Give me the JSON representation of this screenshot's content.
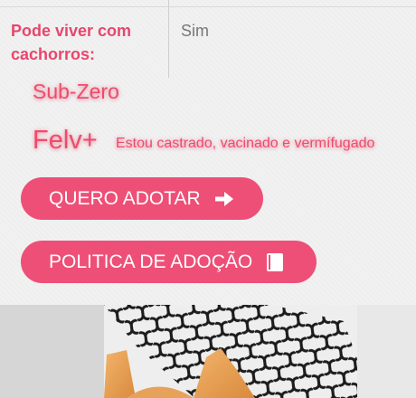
{
  "pet_info": {
    "label": "Pode viver com cachorros:",
    "value": "Sim"
  },
  "tags": {
    "name": "Sub-Zero",
    "condition": "Felv+",
    "health_status": "Estou castrado, vacinado e vermífugado"
  },
  "actions": {
    "adopt_label": "QUERO ADOTAR",
    "adopt_icon": "arrow-right-icon",
    "policy_label": "POLITICA DE ADOÇÃO",
    "policy_icon": "book-icon"
  },
  "colors": {
    "accent": "#ee4f77",
    "label_text": "#e8466c",
    "value_text": "#777777",
    "panel_bg": "#f1f1f1"
  }
}
